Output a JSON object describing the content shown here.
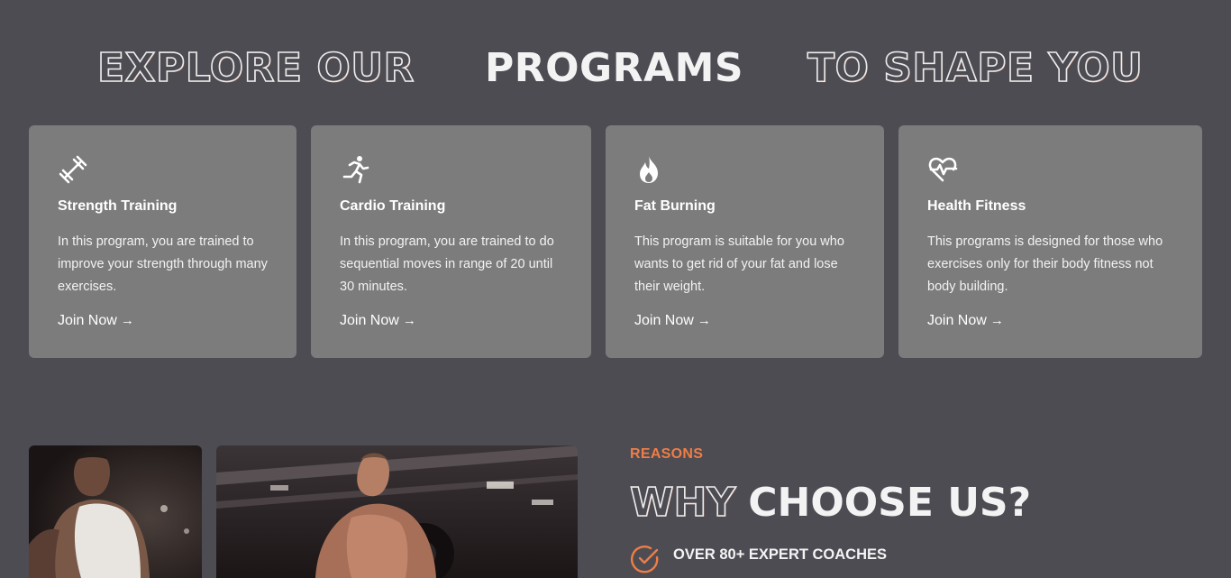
{
  "programs_heading": {
    "left": "EXPLORE OUR",
    "middle": "PROGRAMS",
    "right": "TO SHAPE YOU"
  },
  "programs": [
    {
      "icon": "dumbbell-icon",
      "title": "Strength Training",
      "description": "In this program, you are trained to improve your strength through many exercises.",
      "link": "Join Now"
    },
    {
      "icon": "running-icon",
      "title": "Cardio Training",
      "description": "In this program, you are trained to do sequential moves in range of 20 until 30 minutes.",
      "link": "Join Now"
    },
    {
      "icon": "flame-icon",
      "title": "Fat Burning",
      "description": "This program is suitable for you who wants to get rid of your fat and lose their weight.",
      "link": "Join Now"
    },
    {
      "icon": "heart-pulse-icon",
      "title": "Health Fitness",
      "description": "This programs is designed for those who exercises only for their body fitness not body building.",
      "link": "Join Now"
    }
  ],
  "reasons": {
    "eyebrow": "REASONS",
    "heading_outline": "WHY",
    "heading_solid": "CHOOSE US?",
    "items": [
      {
        "icon": "check-circle-icon",
        "text": "OVER 80+ EXPERT COACHES"
      }
    ]
  },
  "colors": {
    "background": "#4d4c53",
    "card": "#7c7c7d",
    "accent": "#ef7d45",
    "text": "#ffffff"
  }
}
